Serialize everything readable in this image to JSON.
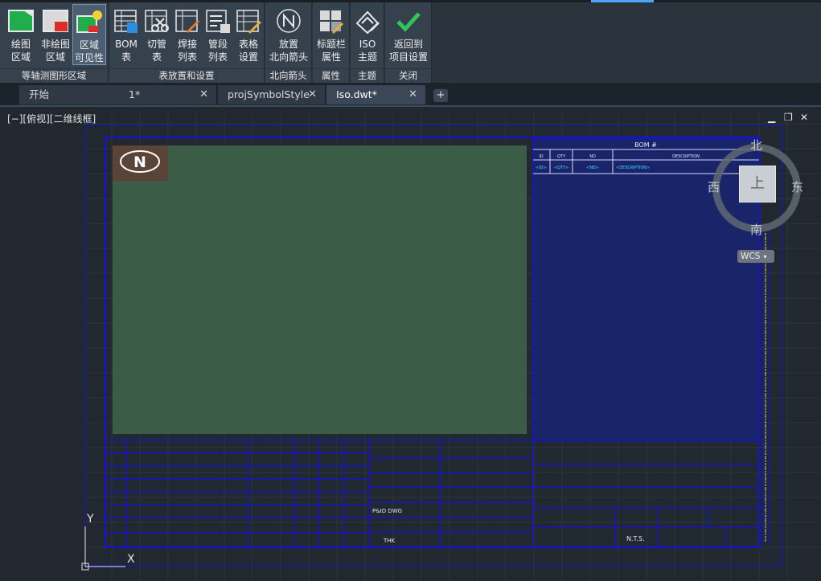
{
  "ribbon": {
    "panels": [
      {
        "label": "等轴测图形区域",
        "buttons": [
          {
            "line1": "绘图",
            "line2": "区域",
            "icon": "draw-region-icon"
          },
          {
            "line1": "非绘图",
            "line2": "区域",
            "icon": "non-draw-region-icon"
          },
          {
            "line1": "区域",
            "line2": "可见性",
            "icon": "region-visibility-icon"
          }
        ]
      },
      {
        "label": "表放置和设置",
        "buttons": [
          {
            "line1": "BOM",
            "line2": "表",
            "icon": "bom-table-icon"
          },
          {
            "line1": "切管",
            "line2": "表",
            "icon": "cut-pipe-table-icon"
          },
          {
            "line1": "焊接",
            "line2": "列表",
            "icon": "weld-list-icon"
          },
          {
            "line1": "管段",
            "line2": "列表",
            "icon": "spool-list-icon"
          },
          {
            "line1": "表格",
            "line2": "设置",
            "icon": "table-settings-icon"
          }
        ]
      },
      {
        "label": "北向箭头",
        "buttons": [
          {
            "line1": "放置",
            "line2": "北向箭头",
            "icon": "north-arrow-icon"
          }
        ]
      },
      {
        "label": "属性",
        "buttons": [
          {
            "line1": "标题栏",
            "line2": "属性",
            "icon": "title-block-properties-icon"
          }
        ]
      },
      {
        "label": "主题",
        "buttons": [
          {
            "line1": "ISO",
            "line2": "主题",
            "icon": "iso-theme-icon"
          }
        ]
      },
      {
        "label": "关闭",
        "buttons": [
          {
            "line1": "返回到",
            "line2": "项目设置",
            "icon": "checkmark-icon"
          }
        ]
      }
    ]
  },
  "tabs": [
    {
      "label": "开始",
      "closable": false
    },
    {
      "label": "1*",
      "closable": true
    },
    {
      "label": "projSymbolStyle",
      "closable": true
    },
    {
      "label": "Iso.dwt*",
      "closable": true,
      "active": true
    }
  ],
  "tab_add": "+",
  "viewport": {
    "label": "[−][俯视][二维线框]",
    "controls": {
      "minimize": "▁",
      "restore": "❐",
      "close": "✕"
    }
  },
  "viewcube": {
    "north": "北",
    "south": "南",
    "east": "东",
    "west": "西",
    "top": "上",
    "wcs": "WCS"
  },
  "ucs": {
    "x": "X",
    "y": "Y"
  },
  "drawing": {
    "north_symbol": "N",
    "bom_title": "BOM #",
    "bom_headers": [
      "ID",
      "QTY",
      "ND",
      "DESCRIPTION"
    ],
    "bom_row": [
      "<ID>",
      "<QTY>",
      "<ND>",
      "<DESCRIPTION>"
    ],
    "pnid_label": "P&ID DWG",
    "thk_label": "THK",
    "nts_label": "N.T.S.",
    "colors": {
      "draw_area": "#3b5d47",
      "bom_area": "#1a2468",
      "border": "#1212e0",
      "cyan_text": "#34e0ff"
    }
  }
}
